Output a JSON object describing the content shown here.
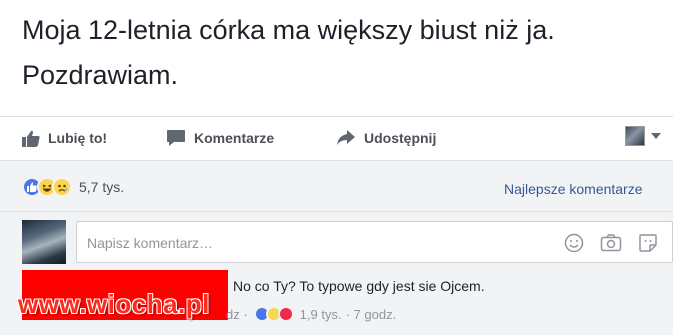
{
  "post": {
    "text_line1": "Moja 12-letnia córka ma większy biust niż ja.",
    "text_line2": "Pozdrawiam."
  },
  "actions": {
    "like_label": "Lubię to!",
    "comment_label": "Komentarze",
    "share_label": "Udostępnij"
  },
  "reactions": {
    "icons": [
      "like-icon",
      "haha-icon",
      "sad-icon"
    ],
    "count": "5,7 tys.",
    "sort_label": "Najlepsze komentarze"
  },
  "composer": {
    "placeholder": "Napisz komentarz…",
    "icons": [
      "emoji-icon",
      "camera-icon",
      "sticker-icon"
    ]
  },
  "comment": {
    "text": "No co Ty? To typowe gdy jest sie Ojcem.",
    "meta_prefix": "dz ·",
    "reaction_count": "1,9 tys.",
    "time": "· 7 godz."
  },
  "watermark": "www.wiocha.pl",
  "colors": {
    "link": "#365899",
    "like_blue": "#4a76e8",
    "redaction": "#ff0000",
    "watermark": "#ff2a1a"
  }
}
